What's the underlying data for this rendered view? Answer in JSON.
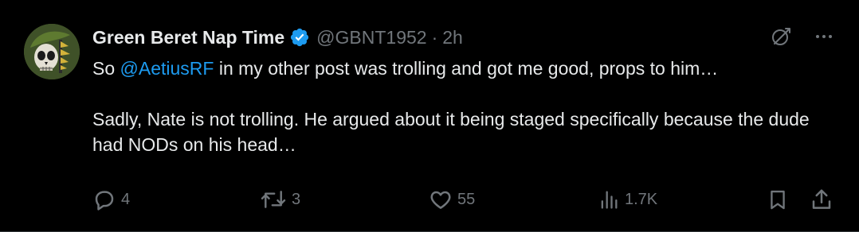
{
  "tweet": {
    "display_name": "Green Beret Nap Time",
    "handle": "@GBNT1952",
    "separator": "·",
    "time": "2h",
    "body": {
      "line1_before": "So ",
      "mention": "@AetiusRF",
      "line1_after": " in my other post was trolling and got me good, props to him…",
      "paragraph2": "Sadly, Nate is not trolling. He argued about it being staged specifically because the dude had NODs on his head…"
    }
  },
  "actions": {
    "replies": "4",
    "reposts": "3",
    "likes": "55",
    "views": "1.7K"
  },
  "icons": {
    "verified": "verified-badge-icon",
    "grok": "grok-icon",
    "more": "more-icon",
    "reply": "reply-icon",
    "repost": "repost-icon",
    "like": "heart-icon",
    "views": "views-icon",
    "bookmark": "bookmark-icon",
    "share": "share-icon"
  },
  "colors": {
    "background": "#000000",
    "text": "#e7e9ea",
    "muted": "#71767b",
    "accent": "#1d9bf0"
  }
}
